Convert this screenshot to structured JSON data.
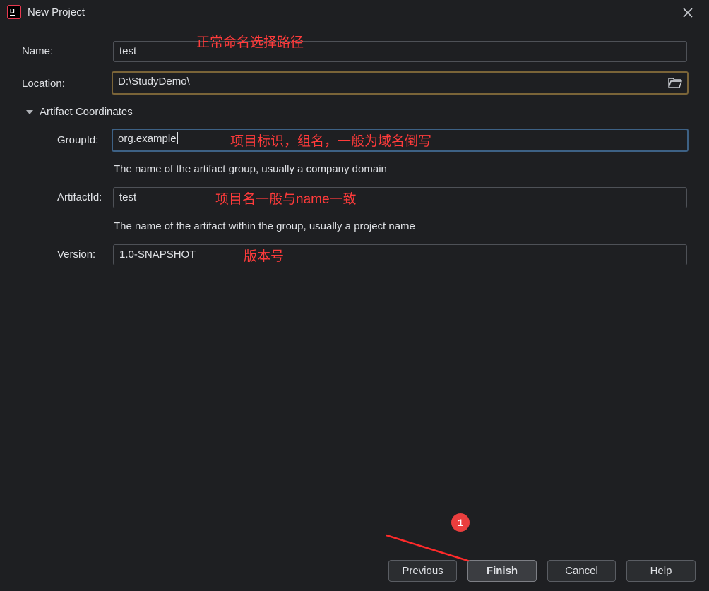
{
  "window": {
    "title": "New Project",
    "app_icon": "intellij-idea-icon",
    "close_icon": "close-icon"
  },
  "form": {
    "name": {
      "label": "Name:",
      "value": "test"
    },
    "location": {
      "label": "Location:",
      "value": "D:\\StudyDemo\\",
      "browse_icon": "folder-open-icon"
    },
    "artifact_section": {
      "label": "Artifact Coordinates",
      "expanded": true,
      "group_id": {
        "label": "GroupId:",
        "value": "org.example",
        "hint": "The name of the artifact group, usually a company domain"
      },
      "artifact_id": {
        "label": "ArtifactId:",
        "value": "test",
        "hint": "The name of the artifact within the group, usually a project name"
      },
      "version": {
        "label": "Version:",
        "value": "1.0-SNAPSHOT"
      }
    }
  },
  "annotations": {
    "name_note": "正常命名选择路径",
    "group_note": "项目标识，组名，一般为域名倒写",
    "artifact_note": "项目名一般与name一致",
    "version_note": "版本号",
    "step_badge": "1",
    "color": "#ff3b3b"
  },
  "buttons": {
    "previous": "Previous",
    "finish": "Finish",
    "cancel": "Cancel",
    "help": "Help"
  },
  "colors": {
    "background": "#1e1f22",
    "location_border": "#7a6438",
    "focus_border": "#3d6185",
    "annotation": "#ff3b3b"
  }
}
